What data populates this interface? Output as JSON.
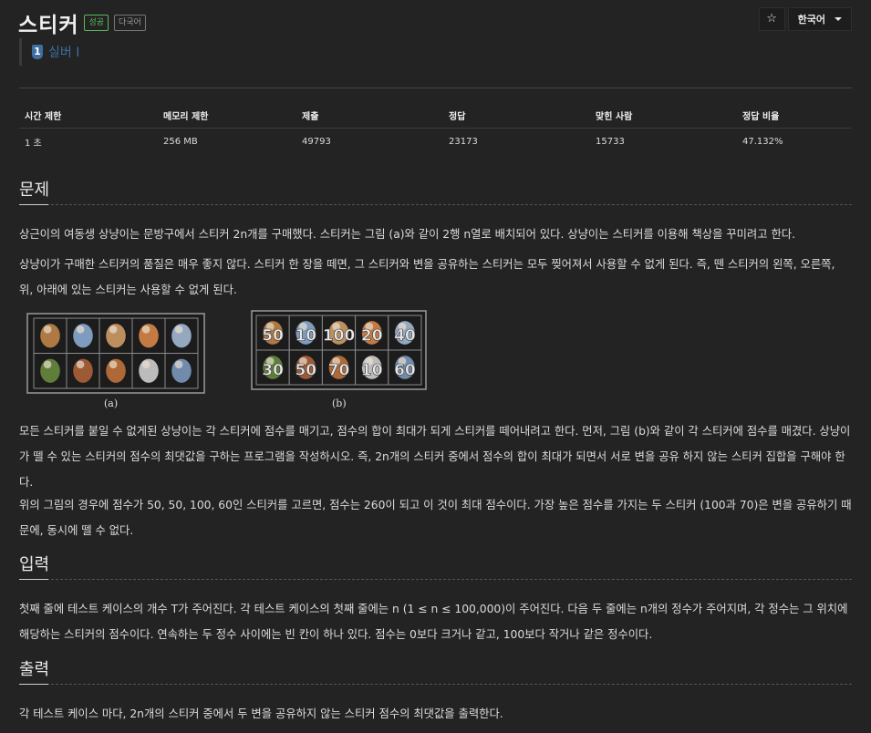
{
  "problem": {
    "title": "스티커",
    "labels": {
      "success": "성공",
      "multilang": "다국어"
    },
    "tier": {
      "number": "1",
      "name": "실버 I"
    }
  },
  "toolbar": {
    "star": "☆",
    "language": "한국어"
  },
  "info_table": {
    "headers": [
      "시간 제한",
      "메모리 제한",
      "제출",
      "정답",
      "맞힌 사람",
      "정답 비율"
    ],
    "values": [
      "1 초",
      "256 MB",
      "49793",
      "23173",
      "15733",
      "47.132%"
    ]
  },
  "sections": {
    "problem_title": "문제",
    "input_title": "입력",
    "output_title": "출력"
  },
  "text": {
    "p1": "상근이의 여동생 상냥이는 문방구에서 스티커 2n개를 구매했다. 스티커는 그림 (a)와 같이 2행 n열로 배치되어 있다. 상냥이는 스티커를 이용해 책상을 꾸미려고 한다.",
    "p2": "상냥이가 구매한 스티커의 품질은 매우 좋지 않다. 스티커 한 장을 떼면, 그 스티커와 변을 공유하는 스티커는 모두 찢어져서 사용할 수 없게 된다. 즉, 뗀 스티커의 왼쪽, 오른쪽, 위, 아래에 있는 스티커는 사용할 수 없게 된다.",
    "p3": "모든 스티커를 붙일 수 없게된 상냥이는 각 스티커에 점수를 매기고, 점수의 합이 최대가 되게 스티커를 떼어내려고 한다. 먼저, 그림 (b)와 같이 각 스티커에 점수를 매겼다. 상냥이가 뗄 수 있는 스티커의 점수의 최댓값을 구하는 프로그램을 작성하시오. 즉, 2n개의 스티커 중에서 점수의 합이 최대가 되면서 서로 변을 공유 하지 않는 스티커 집합을 구해야 한다.",
    "p4": "위의 그림의 경우에 점수가 50, 50, 100, 60인 스티커를 고르면, 점수는 260이 되고 이 것이 최대 점수이다. 가장 높은 점수를 가지는 두 스티커 (100과 70)은 변을 공유하기 때문에, 동시에 뗄 수 없다.",
    "input": "첫째 줄에 테스트 케이스의 개수 T가 주어진다. 각 테스트 케이스의 첫째 줄에는 n (1 ≤ n ≤ 100,000)이 주어진다. 다음 두 줄에는 n개의 정수가 주어지며, 각 정수는 그 위치에 해당하는 스티커의 점수이다. 연속하는 두 정수 사이에는 빈 칸이 하나 있다. 점수는 0보다 크거나 같고, 100보다 작거나 같은 정수이다.",
    "output": "각 테스트 케이스 마다, 2n개의 스티커 중에서 두 변을 공유하지 않는 스티커 점수의 최댓값을 출력한다."
  },
  "figure": {
    "caption_a": "(a)",
    "caption_b": "(b)",
    "scores_top": [
      "50",
      "10",
      "100",
      "20",
      "40"
    ],
    "scores_bottom": [
      "30",
      "50",
      "70",
      "10",
      "60"
    ],
    "colors": {
      "sticker_bg": "#1a1a1a",
      "sticker_border": "#9a9a9a",
      "score": "#e8e8e8"
    }
  }
}
